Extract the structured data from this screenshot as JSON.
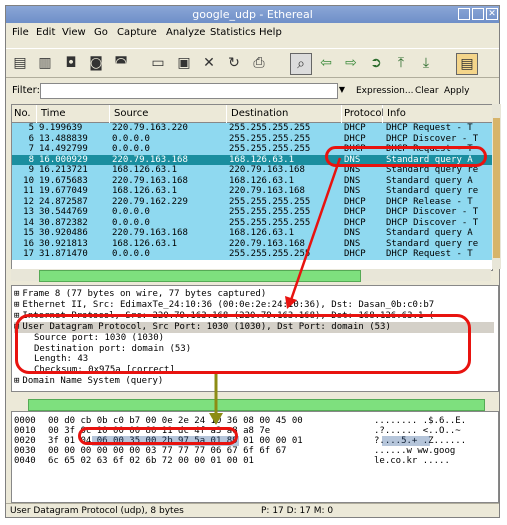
{
  "window": {
    "title": "google_udp - Ethereal"
  },
  "menu": [
    "File",
    "Edit",
    "View",
    "Go",
    "Capture",
    "Analyze",
    "Statistics",
    "Help"
  ],
  "filter": {
    "label": "Filter:",
    "value": "",
    "expression": "Expression...",
    "clear": "Clear",
    "apply": "Apply"
  },
  "packet_list": {
    "columns": [
      "No.",
      "Time",
      "Source",
      "Destination",
      "Protocol",
      "Info"
    ],
    "rows": [
      {
        "no": "5",
        "time": "9.199639",
        "src": "220.79.163.220",
        "dst": "255.255.255.255",
        "proto": "DHCP",
        "info": "DHCP Request  - T",
        "selected": false
      },
      {
        "no": "6",
        "time": "13.488839",
        "src": "0.0.0.0",
        "dst": "255.255.255.255",
        "proto": "DHCP",
        "info": "DHCP Discover - T",
        "selected": false
      },
      {
        "no": "7",
        "time": "14.492799",
        "src": "0.0.0.0",
        "dst": "255.255.255.255",
        "proto": "DHCP",
        "info": "DHCP Request  - T",
        "selected": false
      },
      {
        "no": "8",
        "time": "16.000929",
        "src": "220.79.163.168",
        "dst": "168.126.63.1",
        "proto": "DNS",
        "info": "Standard query A",
        "selected": true
      },
      {
        "no": "9",
        "time": "16.213721",
        "src": "168.126.63.1",
        "dst": "220.79.163.168",
        "proto": "DNS",
        "info": "Standard query re",
        "selected": false
      },
      {
        "no": "10",
        "time": "19.675683",
        "src": "220.79.163.168",
        "dst": "168.126.63.1",
        "proto": "DNS",
        "info": "Standard query A",
        "selected": false
      },
      {
        "no": "11",
        "time": "19.677049",
        "src": "168.126.63.1",
        "dst": "220.79.163.168",
        "proto": "DNS",
        "info": "Standard query re",
        "selected": false
      },
      {
        "no": "12",
        "time": "24.872587",
        "src": "220.79.162.229",
        "dst": "255.255.255.255",
        "proto": "DHCP",
        "info": "DHCP Release  - T",
        "selected": false
      },
      {
        "no": "13",
        "time": "30.544769",
        "src": "0.0.0.0",
        "dst": "255.255.255.255",
        "proto": "DHCP",
        "info": "DHCP Discover - T",
        "selected": false
      },
      {
        "no": "14",
        "time": "30.872382",
        "src": "0.0.0.0",
        "dst": "255.255.255.255",
        "proto": "DHCP",
        "info": "DHCP Discover - T",
        "selected": false
      },
      {
        "no": "15",
        "time": "30.920486",
        "src": "220.79.163.168",
        "dst": "168.126.63.1",
        "proto": "DNS",
        "info": "Standard query A",
        "selected": false
      },
      {
        "no": "16",
        "time": "30.921813",
        "src": "168.126.63.1",
        "dst": "220.79.163.168",
        "proto": "DNS",
        "info": "Standard query re",
        "selected": false
      },
      {
        "no": "17",
        "time": "31.871470",
        "src": "0.0.0.0",
        "dst": "255.255.255.255",
        "proto": "DHCP",
        "info": "DHCP Request  - T",
        "selected": false
      }
    ]
  },
  "details": [
    {
      "text": "Frame 8 (77 bytes on wire, 77 bytes captured)",
      "expander": "⊞"
    },
    {
      "text": "Ethernet II, Src: EdimaxTe_24:10:36 (00:0e:2e:24:10:36), Dst: Dasan_0b:c0:b7",
      "expander": "⊞"
    },
    {
      "text": "Internet Protocol, Src: 220.79.163.168 (220.79.163.168), Dst: 168.126.63.1 (",
      "expander": "⊞"
    },
    {
      "text": "User Datagram Protocol, Src Port: 1030 (1030), Dst Port: domain (53)",
      "expander": "⊟"
    },
    {
      "text": "Source port: 1030 (1030)",
      "expander": ""
    },
    {
      "text": "Destination port: domain (53)",
      "expander": ""
    },
    {
      "text": "Length: 43",
      "expander": ""
    },
    {
      "text": "Checksum: 0x975a [correct]",
      "expander": ""
    },
    {
      "text": "Domain Name System (query)",
      "expander": "⊞"
    }
  ],
  "hex_dump": [
    {
      "offset": "0000",
      "hex": "00 d0 cb 0b c0 b7 00 0e  2e 24 10 36 08 00 45 00",
      "ascii": "........ .$.6..E."
    },
    {
      "offset": "0010",
      "hex": "00 3f 0c 10 00 00 80 11  dc 4f a3 a8 a8 7e",
      "ascii": ".?...... <..O..~"
    },
    {
      "offset": "0020",
      "hex": "3f 01 04 06 00 35 00 2b  97 5a 01 89 01 00 00 01",
      "ascii": "?....5.+ .Z......"
    },
    {
      "offset": "0030",
      "hex": "00 00 00 00 00 00 03 77  77 77 06 67 6f 6f 67",
      "ascii": "......w ww.goog"
    },
    {
      "offset": "0040",
      "hex": "6c 65 02 63 6f 02 6b 72  00 00 01 00 01",
      "ascii": "le.co.kr ....."
    }
  ],
  "status": {
    "left": "User Datagram Protocol (udp), 8 bytes",
    "right": "P: 17 D: 17 M: 0"
  },
  "colors": {
    "row_bg": "#8fd9f0",
    "selected_bg": "#1a8e9f",
    "annotation": "#e8130f",
    "arrow_green": "#8c8c14"
  }
}
